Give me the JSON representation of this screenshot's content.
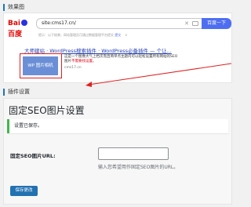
{
  "preview_section": {
    "title": "效果图"
  },
  "baidu": {
    "logo_text_1": "Bai",
    "logo_text_2": "百度",
    "query": "site:cms17.cn/",
    "search_button": "百度一下",
    "tip_text": "提示：以下结果，网站管理员可通过数据管理平台提交",
    "tip_link": "提交",
    "tip_close": "x",
    "result_title": "大师建站 · WordPress搜索插件 · WordPress必备插件 — 个让...",
    "thumbnail_text": "WP 图片相机",
    "snippet": "这是一个图像大气上档次而且简单点主题内可以轻松设置所有网站的SEO 图片",
    "snippet_red": "不需要找设置。",
    "snippet_source": "cms17.cn"
  },
  "plugin_section": {
    "title": "插件设置"
  },
  "settings": {
    "page_title": "固定SEO图片设置",
    "notice": "设置已保存。",
    "field_label": "固定SEO图片URL:",
    "field_value": "",
    "field_description": "输入您希望用作固定SEO图片的URL。",
    "save_button": "保存更改"
  },
  "colors": {
    "accent": "#2271b1",
    "notice_border": "#46b450",
    "highlight": "#e02020",
    "baidu_blue": "#4e6ef2"
  }
}
